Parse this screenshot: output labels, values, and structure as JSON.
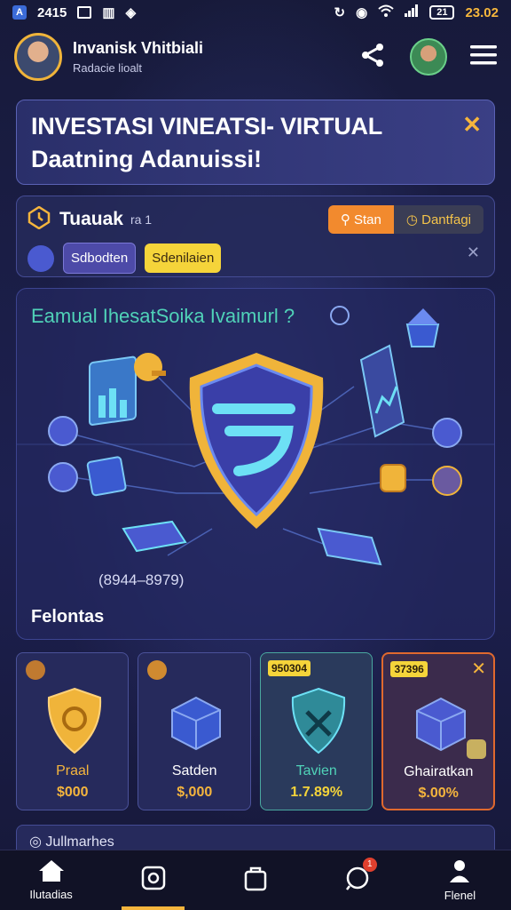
{
  "status_bar": {
    "app_icon": "A",
    "time_left": "2415",
    "battery": "21",
    "clock": "23.02"
  },
  "header": {
    "user_name": "Invanisk Vhitbiali",
    "user_sub": "Radacie lioalt"
  },
  "banner": {
    "title": "INVESTASI VINEATSI- VIRTUAL",
    "subtitle": "Daatning Adanuissi!"
  },
  "task_panel": {
    "title": "Tuauak",
    "count": "ra 1",
    "btn_search": "Stan",
    "btn_dashboard": "Dantfagi",
    "chip_purple": "Sdbodten",
    "chip_yellow": "Sdenilaien"
  },
  "hero": {
    "title": "Eamual IhesatSoika Ivaimurl ?",
    "range": "(8944–8979)",
    "footer": "Felontas"
  },
  "cards": [
    {
      "name": "Praal",
      "price": "$000",
      "badge": ""
    },
    {
      "name": "Satden",
      "price": "$,000",
      "badge": ""
    },
    {
      "name": "Tavien",
      "price": "1.7.89%",
      "badge": "950304"
    },
    {
      "name": "Ghairatkan",
      "price": "$.00%",
      "badge": "37396"
    }
  ],
  "peek": {
    "label": "Jullmarhes"
  },
  "tabs": [
    {
      "label": "Ilutadias"
    },
    {
      "label": ""
    },
    {
      "label": ""
    },
    {
      "label": "",
      "badge": "1"
    },
    {
      "label": "Flenel"
    }
  ],
  "colors": {
    "accent": "#f5b53d",
    "teal": "#50d2b8",
    "background": "#1a1c3f"
  }
}
